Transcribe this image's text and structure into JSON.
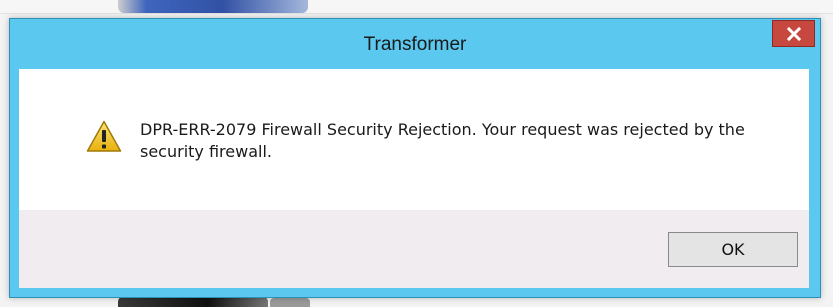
{
  "dialog": {
    "title": "Transformer",
    "message": "DPR-ERR-2079 Firewall Security Rejection. Your request was rejected by the security firewall.",
    "ok_label": "OK",
    "icon": "warning-icon",
    "close_icon": "close-icon"
  },
  "colors": {
    "titlebar": "#5bc8ef",
    "close_button": "#c7483f",
    "content_bg": "#ffffff",
    "footer_bg": "#f0ecef",
    "warning_yellow": "#f5c518"
  }
}
